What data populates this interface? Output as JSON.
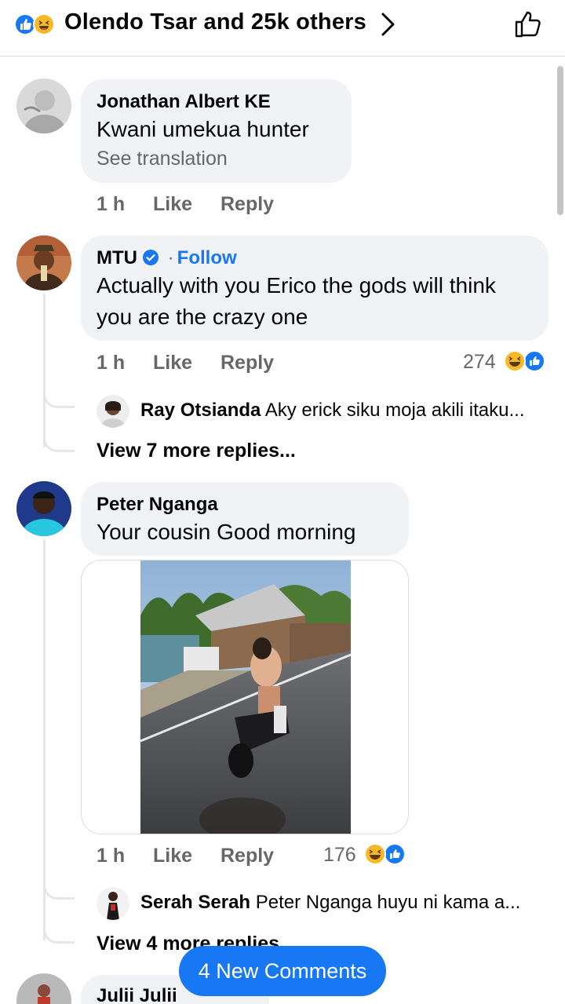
{
  "header": {
    "reactions_title": "Olendo Tsar and 25k others",
    "reaction_icons": [
      "like-icon",
      "haha-icon"
    ],
    "accent": "#1877f2"
  },
  "comments": [
    {
      "author": "Jonathan Albert KE",
      "text": "Kwani umekua hunter",
      "see_translation": "See translation",
      "time": "1 h",
      "like": "Like",
      "reply": "Reply"
    },
    {
      "author": "MTU",
      "separator": "·",
      "follow": "Follow",
      "text": "Actually with you Erico the gods will think you are the crazy one",
      "time": "1 h",
      "like": "Like",
      "reply": "Reply",
      "reaction_count": "274",
      "reply_preview": {
        "author": "Ray Otsianda",
        "text": "Aky erick siku moja akili itaku..."
      },
      "view_more": "View 7 more replies..."
    },
    {
      "author": "Peter Nganga",
      "text": "Your cousin Good morning",
      "time": "1 h",
      "like": "Like",
      "reply": "Reply",
      "reaction_count": "176",
      "reply_preview": {
        "author": "Serah Serah",
        "text": "Peter Nganga huyu ni kama a..."
      },
      "view_more": "View 4 more replies..."
    },
    {
      "author": "Julii Julii"
    }
  ],
  "new_comments_button": "4 New Comments"
}
